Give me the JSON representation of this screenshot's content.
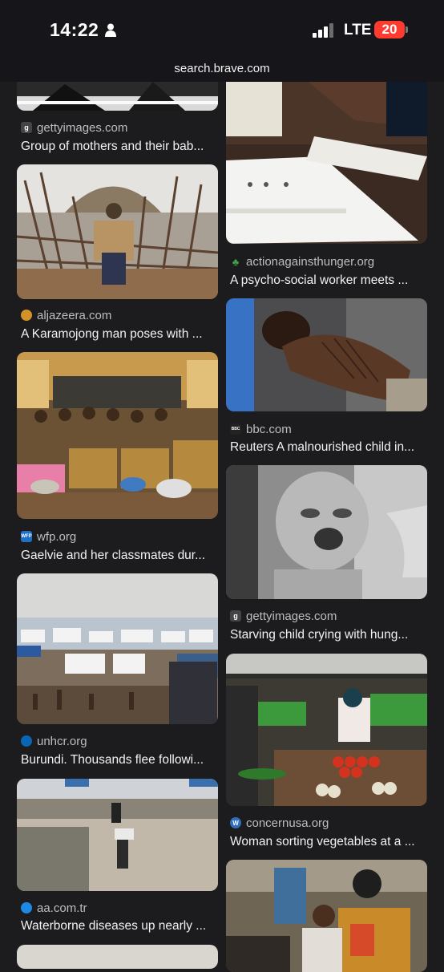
{
  "status_bar": {
    "time": "14:22",
    "network": "LTE",
    "battery": "20"
  },
  "url_bar": {
    "url": "search.brave.com"
  },
  "left_column": [
    {
      "source": "gettyimages.com",
      "caption": "Group of mothers and their bab...",
      "favicon": "g"
    },
    {
      "source": "aljazeera.com",
      "caption": "A Karamojong man poses with ...",
      "favicon": ""
    },
    {
      "source": "wfp.org",
      "caption": "Gaelvie and her classmates dur...",
      "favicon": "WFP"
    },
    {
      "source": "unhcr.org",
      "caption": "Burundi. Thousands flee followi...",
      "favicon": ""
    },
    {
      "source": "aa.com.tr",
      "caption": "Waterborne diseases up nearly ...",
      "favicon": ""
    }
  ],
  "right_column": [
    {
      "source": "actionagainsthunger.org",
      "caption": "A psycho-social worker meets ...",
      "favicon": ""
    },
    {
      "source": "bbc.com",
      "caption": "Reuters A malnourished child in...",
      "favicon": "BBC"
    },
    {
      "source": "gettyimages.com",
      "caption": "Starving child crying with hung...",
      "favicon": "g"
    },
    {
      "source": "concernusa.org",
      "caption": "Woman sorting vegetables at a ...",
      "favicon": ""
    }
  ],
  "colors": {
    "background": "#1c1c1e",
    "statusbar": "#16161a",
    "battery_low": "#ff3b30",
    "caption": "#f2f2f2",
    "source": "#bdbdc2"
  }
}
